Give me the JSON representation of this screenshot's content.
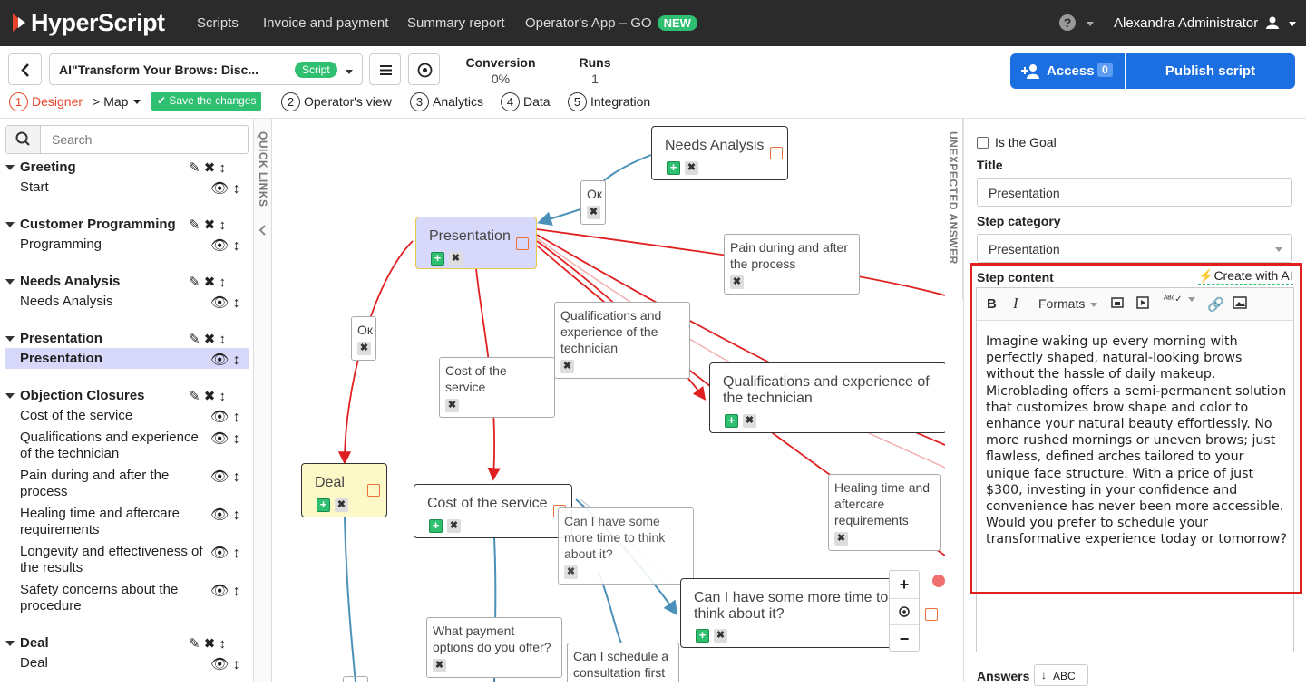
{
  "app": {
    "logo": "HyperScript",
    "nav": [
      "Scripts",
      "Invoice and payment",
      "Summary report",
      "Operator's App – GO"
    ],
    "nav_badge": "NEW",
    "help": "?",
    "user": "Alexandra Administrator"
  },
  "toolbar": {
    "script_title": "AI\"Transform Your Brows: Disc...",
    "script_badge": "Script",
    "conversion_label": "Conversion",
    "conversion_value": "0%",
    "runs_label": "Runs",
    "runs_value": "1",
    "access_label": "Access",
    "access_count": "0",
    "publish_label": "Publish script"
  },
  "stepnav": {
    "designer": "Designer",
    "map": "Map",
    "save": "Save the changes",
    "operator": "Operator's view",
    "analytics": "Analytics",
    "data": "Data",
    "integration": "Integration",
    "n1": "1",
    "n2": "2",
    "n3": "3",
    "n4": "4",
    "n5": "5"
  },
  "sidebar": {
    "search_placeholder": "Search",
    "groups": [
      {
        "title": "Greeting",
        "items": [
          "Start"
        ]
      },
      {
        "title": "Customer Programming",
        "items": [
          "Programming"
        ]
      },
      {
        "title": "Needs Analysis",
        "items": [
          "Needs Analysis"
        ]
      },
      {
        "title": "Presentation",
        "items": [
          "Presentation"
        ]
      },
      {
        "title": "Objection Closures",
        "items": [
          "Cost of the service",
          "Qualifications and experience of the technician",
          "Pain during and after the process",
          "Healing time and aftercare requirements",
          "Longevity and effectiveness of the results",
          "Safety concerns about the procedure"
        ]
      },
      {
        "title": "Deal",
        "items": [
          "Deal"
        ]
      }
    ]
  },
  "quick_links": "QUICK LINKS",
  "unexpected_answer": "UNEXPECTED ANSWER",
  "canvas": {
    "nodes": {
      "needs": "Needs Analysis",
      "presentation": "Presentation",
      "deal": "Deal",
      "cost": "Cost of the service",
      "qual": "Qualifications and experience of the technician",
      "more_time": "Can I have some more time to think about it?"
    },
    "labels": {
      "ok1": "Ок",
      "ok2": "Ок",
      "pain": "Pain during and after the process",
      "qual": "Qualifications and experience of the technician",
      "cost": "Cost of the service",
      "healing": "Healing time and aftercare requirements",
      "more_time": "Can I have some more time to think about it?",
      "payment": "What payment options do you offer?",
      "schedule": "Can I schedule a consultation first to"
    },
    "zoom_in": "+",
    "zoom_out": "−"
  },
  "right_panel": {
    "is_goal": "Is the Goal",
    "title_label": "Title",
    "title_value": "Presentation",
    "category_label": "Step category",
    "category_value": "Presentation",
    "content_label": "Step content",
    "create_ai": "Create with AI",
    "formats": "Formats",
    "content": "Imagine waking up every morning with perfectly shaped, natural-looking brows without the hassle of daily makeup. Microblading offers a semi-permanent solution that customizes brow shape and color to enhance your natural beauty effortlessly. No more rushed mornings or uneven brows; just flawless, defined arches tailored to your unique face structure. With a price of just $300, investing in your confidence and convenience has never been more accessible. Would you prefer to schedule your transformative experience today or tomorrow?",
    "answers_label": "Answers",
    "sort_label": "ABC"
  },
  "colors": {
    "accent": "#1b6fe0",
    "success": "#2fbf71",
    "highlight": "#e02020",
    "active_node": "#d8d8fb",
    "deal_node": "#fdf8c8"
  }
}
